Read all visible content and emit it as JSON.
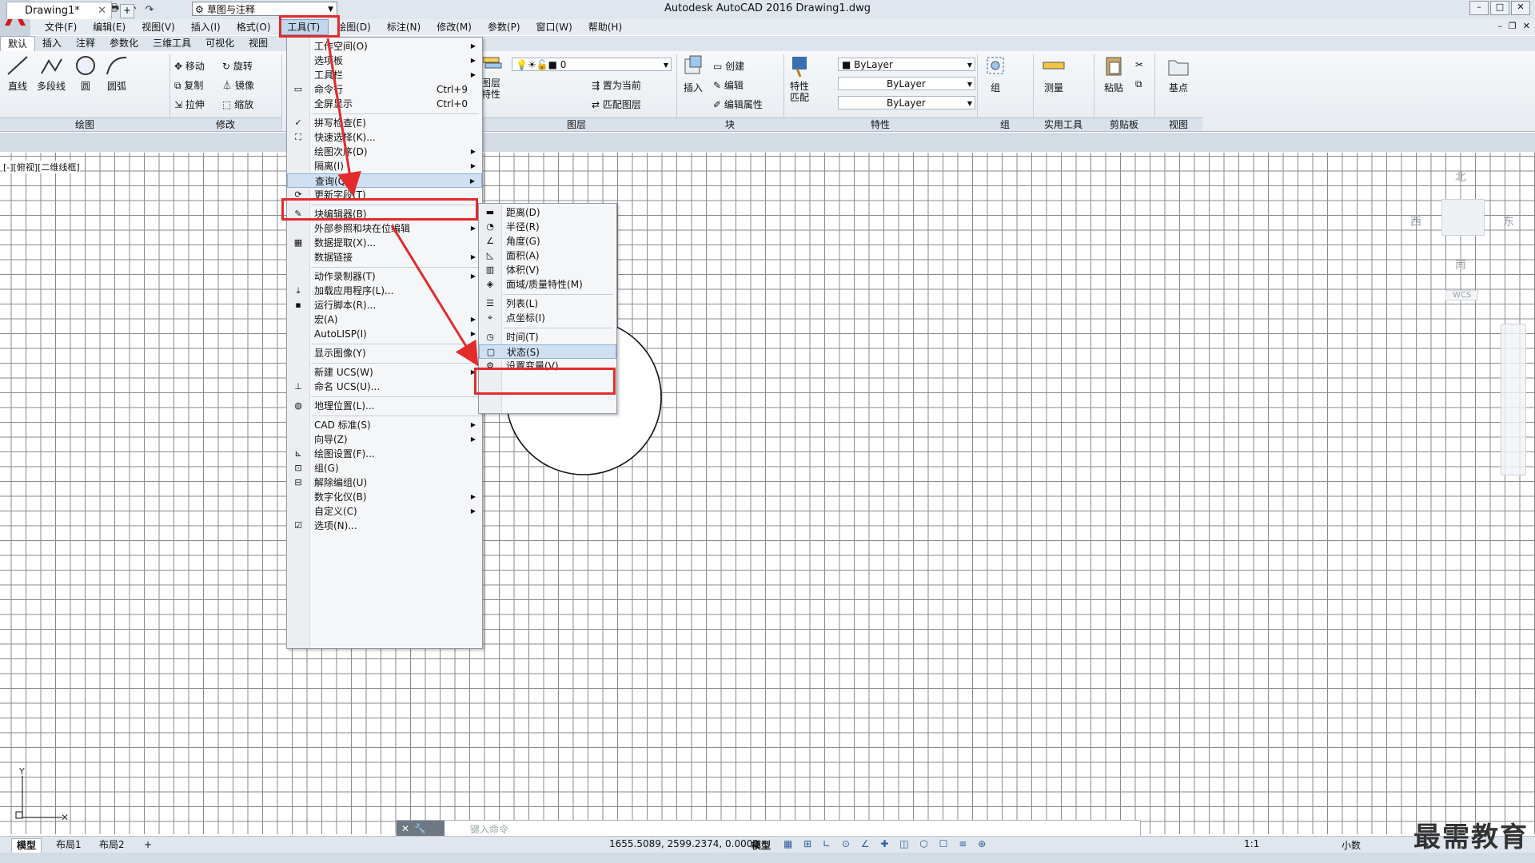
{
  "window": {
    "title": "Autodesk AutoCAD 2016    Drawing1.dwg",
    "workspace": "草图与注释"
  },
  "menubar": [
    "文件(F)",
    "编辑(E)",
    "视图(V)",
    "插入(I)",
    "格式(O)",
    "工具(T)",
    "绘图(D)",
    "标注(N)",
    "修改(M)",
    "参数(P)",
    "窗口(W)",
    "帮助(H)"
  ],
  "ribbon_tabs": [
    "默认",
    "插入",
    "注释",
    "参数化",
    "三维工具",
    "可视化",
    "视图"
  ],
  "ribbon": {
    "draw": {
      "line": "直线",
      "polyline": "多段线",
      "circle": "圆",
      "arc": "圆弧",
      "panel": "绘图"
    },
    "modify": {
      "move": "移动",
      "rotate": "旋转",
      "copy": "复制",
      "mirror": "镜像",
      "stretch": "拉伸",
      "scale": "缩放",
      "panel": "修改"
    },
    "layers": {
      "layer_props": "图层特性",
      "layer_value": "0",
      "set_current": "置为当前",
      "match_layer": "匹配图层",
      "panel": "图层"
    },
    "block": {
      "insert": "插入",
      "create": "创建",
      "edit": "编辑",
      "edit_attr": "编辑属性",
      "panel": "块"
    },
    "properties": {
      "match": "特性匹配",
      "color": "ByLayer",
      "linetype": "ByLayer",
      "lineweight": "ByLayer",
      "panel": "特性"
    },
    "groups": {
      "group": "组",
      "panel": "组"
    },
    "utilities": {
      "measure": "测量",
      "panel": "实用工具"
    },
    "clipboard": {
      "paste": "粘贴",
      "panel": "剪贴板"
    },
    "view": {
      "base": "基点",
      "panel": "视图"
    }
  },
  "doc_tab": "Drawing1*",
  "viewport_label": "[-][俯视][二维线框]",
  "viewcube": {
    "north": "北",
    "south": "南",
    "east": "东",
    "west": "西",
    "wcs": "WCS"
  },
  "tools_menu": [
    {
      "label": "工作空间(O)",
      "sub": true
    },
    {
      "label": "选项板",
      "sub": true
    },
    {
      "label": "工具栏",
      "sub": true
    },
    {
      "label": "命令行",
      "shortcut": "Ctrl+9",
      "icon": "command-line-icon"
    },
    {
      "label": "全屏显示",
      "shortcut": "Ctrl+0"
    },
    {
      "sep": true
    },
    {
      "label": "拼写检查(E)",
      "icon": "spell-check-icon"
    },
    {
      "label": "快速选择(K)...",
      "icon": "quick-select-icon"
    },
    {
      "label": "绘图次序(D)",
      "sub": true
    },
    {
      "label": "隔离(I)",
      "sub": true
    },
    {
      "label": "查询(Q)",
      "sub": true,
      "highlight": true
    },
    {
      "label": "更新字段(T)",
      "icon": "update-field-icon"
    },
    {
      "sep": true
    },
    {
      "label": "块编辑器(B)",
      "icon": "block-editor-icon"
    },
    {
      "label": "外部参照和块在位编辑",
      "sub": true
    },
    {
      "label": "数据提取(X)...",
      "icon": "data-extraction-icon"
    },
    {
      "label": "数据链接",
      "sub": true
    },
    {
      "sep": true
    },
    {
      "label": "动作录制器(T)",
      "sub": true
    },
    {
      "label": "加载应用程序(L)...",
      "icon": "load-app-icon"
    },
    {
      "label": "运行脚本(R)...",
      "icon": "run-script-icon"
    },
    {
      "label": "宏(A)",
      "sub": true
    },
    {
      "label": "AutoLISP(I)",
      "sub": true
    },
    {
      "sep": true
    },
    {
      "label": "显示图像(Y)",
      "sub": true
    },
    {
      "sep": true
    },
    {
      "label": "新建 UCS(W)",
      "sub": true
    },
    {
      "label": "命名 UCS(U)...",
      "icon": "named-ucs-icon"
    },
    {
      "sep": true
    },
    {
      "label": "地理位置(L)...",
      "icon": "globe-icon"
    },
    {
      "sep": true
    },
    {
      "label": "CAD 标准(S)",
      "sub": true
    },
    {
      "label": "向导(Z)",
      "sub": true
    },
    {
      "label": "绘图设置(F)...",
      "icon": "drafting-settings-icon"
    },
    {
      "label": "组(G)",
      "icon": "group-icon"
    },
    {
      "label": "解除编组(U)",
      "icon": "ungroup-icon"
    },
    {
      "label": "数字化仪(B)",
      "sub": true
    },
    {
      "label": "自定义(C)",
      "sub": true
    },
    {
      "label": "选项(N)...",
      "icon": "options-check-icon"
    }
  ],
  "inquiry_menu": [
    {
      "label": "距离(D)",
      "icon": "distance-icon"
    },
    {
      "label": "半径(R)",
      "icon": "radius-icon"
    },
    {
      "label": "角度(G)",
      "icon": "angle-icon"
    },
    {
      "label": "面积(A)",
      "icon": "area-icon"
    },
    {
      "label": "体积(V)",
      "icon": "volume-icon"
    },
    {
      "label": "面域/质量特性(M)",
      "icon": "mass-properties-icon"
    },
    {
      "sep": true
    },
    {
      "label": "列表(L)",
      "icon": "list-icon"
    },
    {
      "label": "点坐标(I)",
      "icon": "point-coords-icon"
    },
    {
      "sep": true
    },
    {
      "label": "时间(T)",
      "icon": "clock-icon"
    },
    {
      "label": "状态(S)",
      "icon": "status-icon",
      "highlight": true
    },
    {
      "label": "设置变量(V)",
      "icon": "setvar-icon"
    }
  ],
  "command_line": {
    "placeholder": "键入命令"
  },
  "layout_tabs": [
    "模型",
    "布局1",
    "布局2"
  ],
  "status": {
    "coords": "1655.5089, 2599.2374, 0.0000",
    "model": "模型",
    "scale": "1:1",
    "units": "小数"
  },
  "watermark": "最需教育",
  "colors": {
    "highlight_red": "#e32b2b",
    "menu_hover": "#cfe0f2"
  }
}
